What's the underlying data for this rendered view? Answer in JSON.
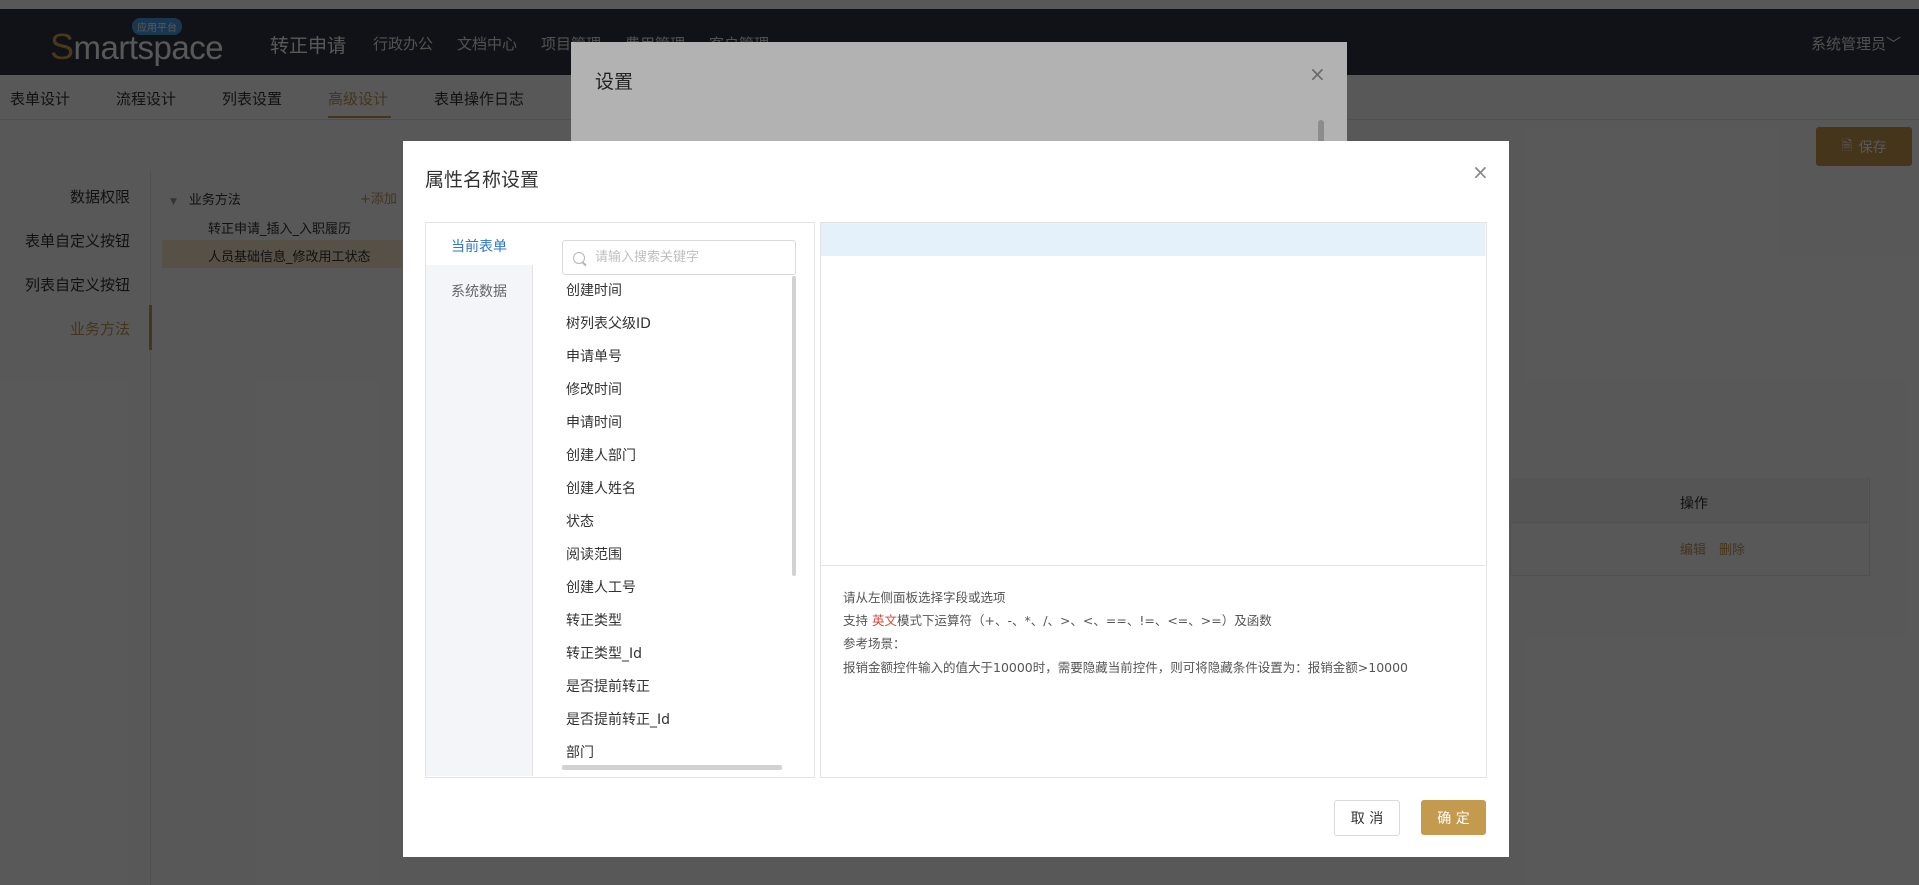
{
  "colors": {
    "accent": "#c49a4e",
    "topbar": "#2f3542",
    "hint_highlight": "#d0483e"
  },
  "app": {
    "logo_s": "S",
    "logo_rest": "martspace",
    "logo_badge": "应用平台",
    "title": "转正申请",
    "nav": [
      "行政办公",
      "文档中心",
      "项目管理",
      "费用管理",
      "客户管理"
    ],
    "user": "系统管理员﹀"
  },
  "subtabs": {
    "items": [
      "表单设计",
      "流程设计",
      "列表设置",
      "高级设计",
      "表单操作日志"
    ],
    "active": "高级设计",
    "save_label": "保存"
  },
  "sidebar": {
    "items": [
      "数据权限",
      "表单自定义按钮",
      "列表自定义按钮",
      "业务方法"
    ],
    "active": "业务方法"
  },
  "tree": {
    "root": "业务方法",
    "add_label": "+添加",
    "nodes": [
      "转正申请_插入_入职履历",
      "人员基础信息_修改用工状态"
    ]
  },
  "bg_table": {
    "op_header": "操作",
    "edit": "编辑",
    "delete": "删除"
  },
  "settings_dialog": {
    "title": "设置",
    "close": "×"
  },
  "dialog": {
    "title": "属性名称设置",
    "close": "×",
    "tabs": [
      "当前表单",
      "系统数据"
    ],
    "active_tab": "当前表单",
    "search": {
      "placeholder": "请输入搜索关键字",
      "value": ""
    },
    "fields": [
      "创建时间",
      "树列表父级ID",
      "申请单号",
      "修改时间",
      "申请时间",
      "创建人部门",
      "创建人姓名",
      "状态",
      "阅读范围",
      "创建人工号",
      "转正类型",
      "转正类型_Id",
      "是否提前转正",
      "是否提前转正_Id",
      "部门"
    ],
    "hint": {
      "line1": "请从左侧面板选择字段或选项",
      "line2_pre": "支持 ",
      "line2_red": "英文",
      "line2_post": "模式下运算符（+、-、*、/、>、<、==、!=、<=、>=）及函数",
      "line3": "参考场景：",
      "line4": "报销金额控件输入的值大于10000时，需要隐藏当前控件，则可将隐藏条件设置为：报销金额>10000"
    },
    "cancel_label": "取 消",
    "ok_label": "确 定"
  }
}
